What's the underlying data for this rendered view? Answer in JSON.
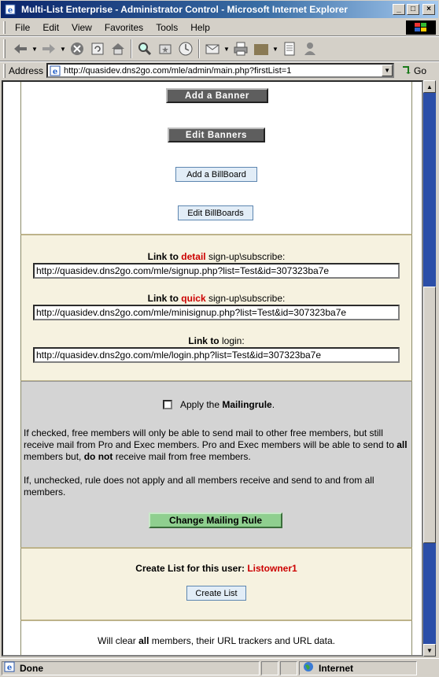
{
  "window": {
    "title": "Multi-List Enterprise - Administrator Control - Microsoft Internet Explorer",
    "minimize": "_",
    "maximize": "□",
    "close": "×"
  },
  "menu": {
    "items": [
      {
        "label": "File"
      },
      {
        "label": "Edit"
      },
      {
        "label": "View"
      },
      {
        "label": "Favorites"
      },
      {
        "label": "Tools"
      },
      {
        "label": "Help"
      }
    ]
  },
  "address": {
    "label": "Address",
    "url": "http://quasidev.dns2go.com/mle/admin/main.php?firstList=1",
    "go_label": "Go"
  },
  "banners": {
    "add_banner": "Add a Banner",
    "edit_banners": "Edit Banners",
    "add_billboard": "Add a BillBoard",
    "edit_billboards": "Edit BillBoards"
  },
  "links": {
    "link_to": "Link to",
    "detail_word": "detail",
    "quick_word": "quick",
    "signup_suffix": "sign-up\\subscribe:",
    "login_suffix": "login:",
    "detail_url": "http://quasidev.dns2go.com/mle/signup.php?list=Test&id=307323ba7e",
    "quick_url": "http://quasidev.dns2go.com/mle/minisignup.php?list=Test&id=307323ba7e",
    "login_url": "http://quasidev.dns2go.com/mle/login.php?list=Test&id=307323ba7e"
  },
  "mailing": {
    "apply_prefix": "Apply the",
    "rule_name": "Mailingrule",
    "apply_suffix": ".",
    "para1_a": "If checked, free members will only be able to send mail to other free members, but still receive mail from Pro and Exec members. Pro and Exec members will be able to send to",
    "para1_all": "all",
    "para1_b": "members but,",
    "para1_donot": "do not",
    "para1_c": "receive mail from free members.",
    "para2": "If, unchecked, rule does not apply and all members receive and send to and from all members.",
    "change_button": "Change Mailing Rule"
  },
  "create": {
    "label": "Create List for this user:",
    "username": "Listowner1",
    "button": "Create List"
  },
  "clear": {
    "prefix": "Will clear",
    "all": "all",
    "suffix": "members, their URL trackers and URL data."
  },
  "status": {
    "left": "Done",
    "zone": "Internet"
  },
  "colors": {
    "accent_red": "#cc0000",
    "title_bar": "#0a246a",
    "scroll_track": "#2b4ea8"
  }
}
